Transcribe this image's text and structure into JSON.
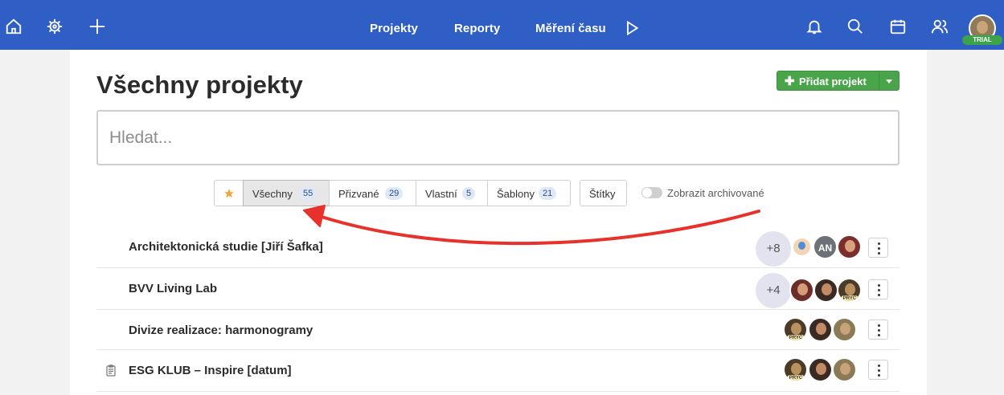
{
  "topbar": {
    "nav": [
      "Projekty",
      "Reporty",
      "Měření času"
    ],
    "trial_badge": "TRIAL"
  },
  "page": {
    "title": "Všechny projekty",
    "add_button": "Přidat projekt",
    "search_placeholder": "Hledat..."
  },
  "filters": [
    {
      "label": "Všechny",
      "count": "55"
    },
    {
      "label": "Přizvané",
      "count": "29"
    },
    {
      "label": "Vlastní",
      "count": "5"
    },
    {
      "label": "Šablony",
      "count": "21"
    }
  ],
  "tags_button": "Štítky",
  "archive_toggle": "Zobrazit archivované",
  "projects": [
    {
      "name": "Architektonická studie [Jiří Šafka]",
      "more": "+8",
      "avatar_text": "AN"
    },
    {
      "name": "BVV Living Lab",
      "more": "+4"
    },
    {
      "name": "Divize realizace: harmonogramy"
    },
    {
      "name": "ESG KLUB – Inspire [datum]"
    }
  ],
  "away_badge": "PRYČ",
  "colors": {
    "topbar": "#2f5fc4",
    "accent_green": "#4aa54a",
    "annotation_arrow": "#e8312a"
  }
}
